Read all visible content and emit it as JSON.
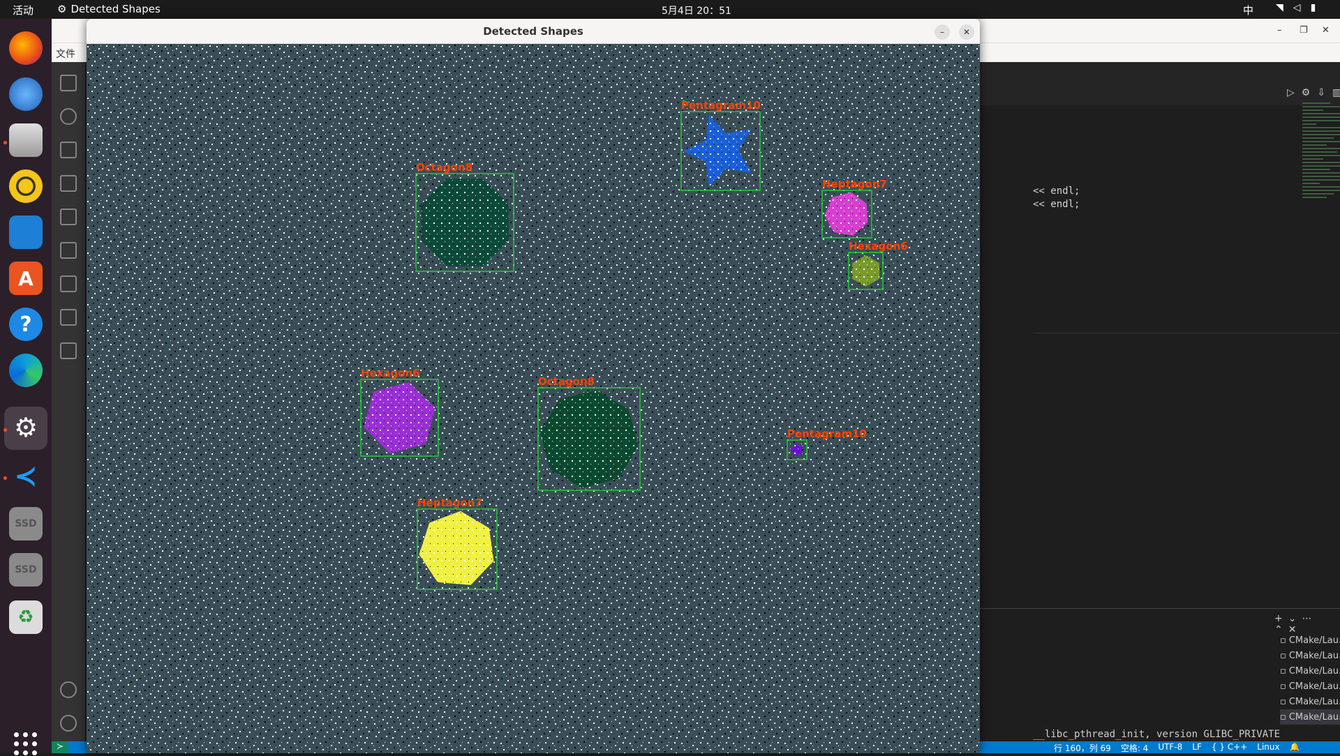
{
  "topbar": {
    "activities": "活动",
    "app_name": "Detected Shapes",
    "clock": "5月4日 20：51",
    "ime": "中"
  },
  "vscode": {
    "menu_first": "文件",
    "code_lines": [
      "<< endl;",
      "<< endl;"
    ],
    "terminals": [
      "CMake/Lau...",
      "CMake/Lau...",
      "CMake/Lau...",
      "CMake/Lau...",
      "CMake/Lau...",
      "CMake/Lau..."
    ],
    "terminal_line": "__libc_pthread_init, version GLIBC_PRIVATE",
    "status": {
      "position": "行 160，列 69",
      "spaces": "空格: 4",
      "encoding": "UTF-8",
      "eol": "LF",
      "language": "{ } C++",
      "platform": "Linux"
    }
  },
  "shapes_window": {
    "title": "Detected Shapes",
    "background_color": "#3a4e58",
    "shapes": [
      {
        "label": "Pentagram10",
        "kind": "star",
        "color": "#1a5fd6"
      },
      {
        "label": "Octagon8",
        "kind": "octagon",
        "color": "#0c4a3a"
      },
      {
        "label": "Heptagon7",
        "kind": "heptagon",
        "color": "#d63fd0"
      },
      {
        "label": "Hexagon6",
        "kind": "hexagon",
        "color": "#7a9a2a"
      },
      {
        "label": "Hexagon6",
        "kind": "hexagon",
        "color": "#9a2fd4"
      },
      {
        "label": "Octagon8",
        "kind": "octagon",
        "color": "#0a4a30"
      },
      {
        "label": "Pentagram10",
        "kind": "star",
        "color": "#6a10d8"
      },
      {
        "label": "Heptagon7",
        "kind": "heptagon",
        "color": "#f0f040"
      }
    ],
    "box_color": "#22cc33",
    "label_color": "#ff4500"
  }
}
